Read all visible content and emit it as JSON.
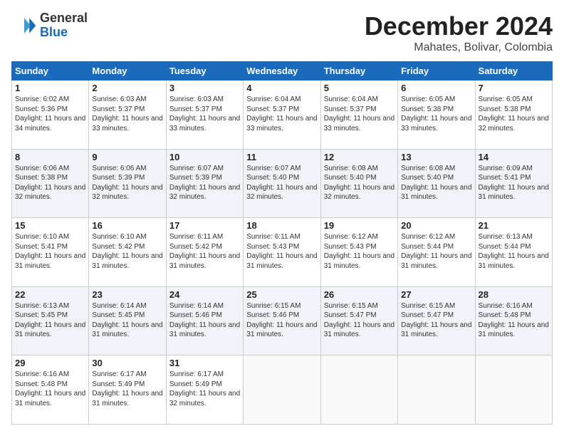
{
  "logo": {
    "general": "General",
    "blue": "Blue"
  },
  "title": "December 2024",
  "location": "Mahates, Bolivar, Colombia",
  "days_of_week": [
    "Sunday",
    "Monday",
    "Tuesday",
    "Wednesday",
    "Thursday",
    "Friday",
    "Saturday"
  ],
  "weeks": [
    [
      {
        "day": "1",
        "sunrise": "6:02 AM",
        "sunset": "5:36 PM",
        "daylight": "11 hours and 34 minutes."
      },
      {
        "day": "2",
        "sunrise": "6:03 AM",
        "sunset": "5:37 PM",
        "daylight": "11 hours and 33 minutes."
      },
      {
        "day": "3",
        "sunrise": "6:03 AM",
        "sunset": "5:37 PM",
        "daylight": "11 hours and 33 minutes."
      },
      {
        "day": "4",
        "sunrise": "6:04 AM",
        "sunset": "5:37 PM",
        "daylight": "11 hours and 33 minutes."
      },
      {
        "day": "5",
        "sunrise": "6:04 AM",
        "sunset": "5:37 PM",
        "daylight": "11 hours and 33 minutes."
      },
      {
        "day": "6",
        "sunrise": "6:05 AM",
        "sunset": "5:38 PM",
        "daylight": "11 hours and 33 minutes."
      },
      {
        "day": "7",
        "sunrise": "6:05 AM",
        "sunset": "5:38 PM",
        "daylight": "11 hours and 32 minutes."
      }
    ],
    [
      {
        "day": "8",
        "sunrise": "6:06 AM",
        "sunset": "5:38 PM",
        "daylight": "11 hours and 32 minutes."
      },
      {
        "day": "9",
        "sunrise": "6:06 AM",
        "sunset": "5:39 PM",
        "daylight": "11 hours and 32 minutes."
      },
      {
        "day": "10",
        "sunrise": "6:07 AM",
        "sunset": "5:39 PM",
        "daylight": "11 hours and 32 minutes."
      },
      {
        "day": "11",
        "sunrise": "6:07 AM",
        "sunset": "5:40 PM",
        "daylight": "11 hours and 32 minutes."
      },
      {
        "day": "12",
        "sunrise": "6:08 AM",
        "sunset": "5:40 PM",
        "daylight": "11 hours and 32 minutes."
      },
      {
        "day": "13",
        "sunrise": "6:08 AM",
        "sunset": "5:40 PM",
        "daylight": "11 hours and 31 minutes."
      },
      {
        "day": "14",
        "sunrise": "6:09 AM",
        "sunset": "5:41 PM",
        "daylight": "11 hours and 31 minutes."
      }
    ],
    [
      {
        "day": "15",
        "sunrise": "6:10 AM",
        "sunset": "5:41 PM",
        "daylight": "11 hours and 31 minutes."
      },
      {
        "day": "16",
        "sunrise": "6:10 AM",
        "sunset": "5:42 PM",
        "daylight": "11 hours and 31 minutes."
      },
      {
        "day": "17",
        "sunrise": "6:11 AM",
        "sunset": "5:42 PM",
        "daylight": "11 hours and 31 minutes."
      },
      {
        "day": "18",
        "sunrise": "6:11 AM",
        "sunset": "5:43 PM",
        "daylight": "11 hours and 31 minutes."
      },
      {
        "day": "19",
        "sunrise": "6:12 AM",
        "sunset": "5:43 PM",
        "daylight": "11 hours and 31 minutes."
      },
      {
        "day": "20",
        "sunrise": "6:12 AM",
        "sunset": "5:44 PM",
        "daylight": "11 hours and 31 minutes."
      },
      {
        "day": "21",
        "sunrise": "6:13 AM",
        "sunset": "5:44 PM",
        "daylight": "11 hours and 31 minutes."
      }
    ],
    [
      {
        "day": "22",
        "sunrise": "6:13 AM",
        "sunset": "5:45 PM",
        "daylight": "11 hours and 31 minutes."
      },
      {
        "day": "23",
        "sunrise": "6:14 AM",
        "sunset": "5:45 PM",
        "daylight": "11 hours and 31 minutes."
      },
      {
        "day": "24",
        "sunrise": "6:14 AM",
        "sunset": "5:46 PM",
        "daylight": "11 hours and 31 minutes."
      },
      {
        "day": "25",
        "sunrise": "6:15 AM",
        "sunset": "5:46 PM",
        "daylight": "11 hours and 31 minutes."
      },
      {
        "day": "26",
        "sunrise": "6:15 AM",
        "sunset": "5:47 PM",
        "daylight": "11 hours and 31 minutes."
      },
      {
        "day": "27",
        "sunrise": "6:15 AM",
        "sunset": "5:47 PM",
        "daylight": "11 hours and 31 minutes."
      },
      {
        "day": "28",
        "sunrise": "6:16 AM",
        "sunset": "5:48 PM",
        "daylight": "11 hours and 31 minutes."
      }
    ],
    [
      {
        "day": "29",
        "sunrise": "6:16 AM",
        "sunset": "5:48 PM",
        "daylight": "11 hours and 31 minutes."
      },
      {
        "day": "30",
        "sunrise": "6:17 AM",
        "sunset": "5:49 PM",
        "daylight": "11 hours and 31 minutes."
      },
      {
        "day": "31",
        "sunrise": "6:17 AM",
        "sunset": "5:49 PM",
        "daylight": "11 hours and 32 minutes."
      },
      null,
      null,
      null,
      null
    ]
  ]
}
